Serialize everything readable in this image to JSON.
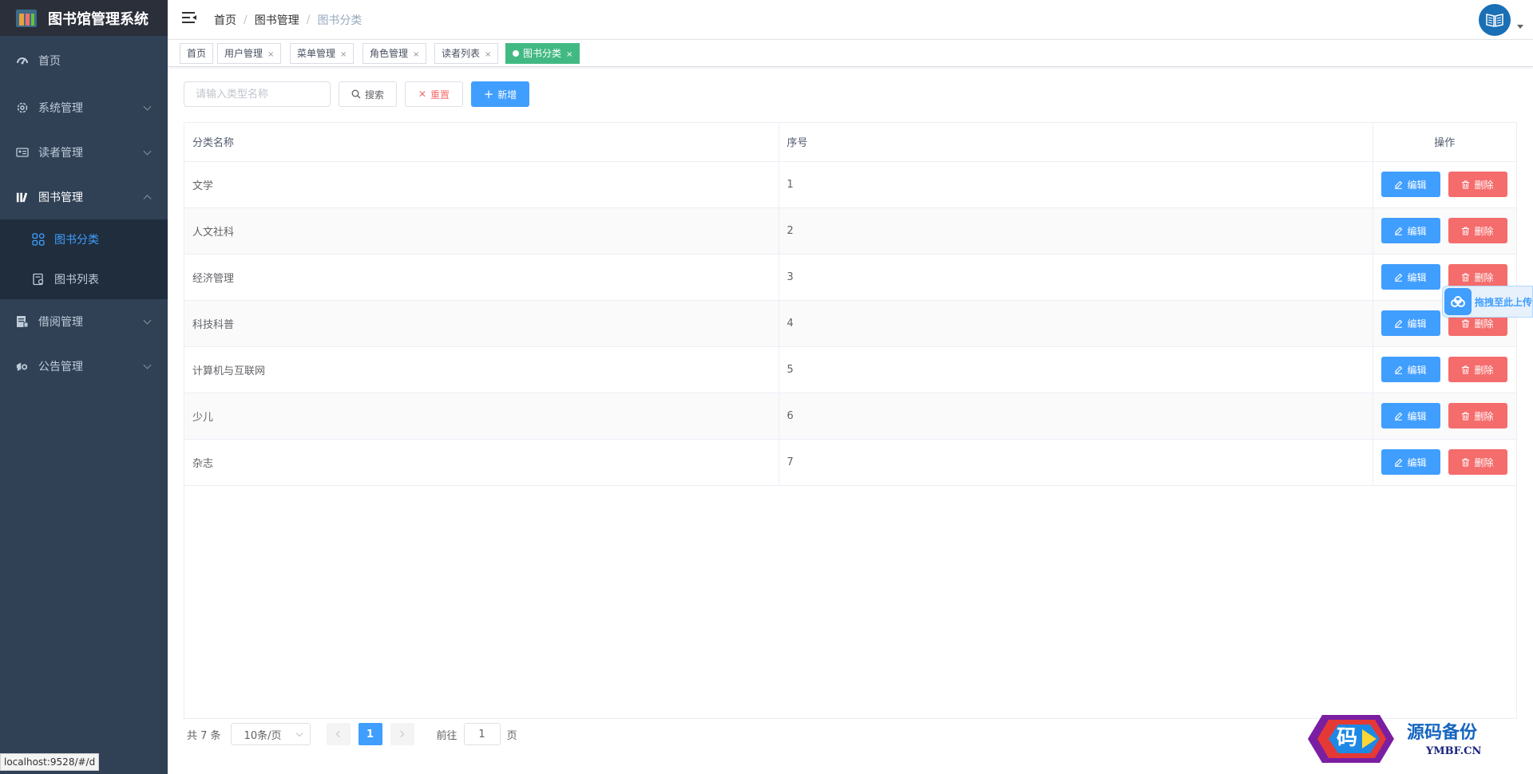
{
  "app": {
    "title": "图书馆管理系统"
  },
  "sidebar": {
    "items": [
      {
        "label": "首页",
        "icon": "dashboard-icon"
      },
      {
        "label": "系统管理",
        "icon": "gear-icon"
      },
      {
        "label": "读者管理",
        "icon": "id-card-icon"
      },
      {
        "label": "图书管理",
        "icon": "books-icon"
      },
      {
        "label": "借阅管理",
        "icon": "borrow-icon"
      },
      {
        "label": "公告管理",
        "icon": "announcement-icon"
      }
    ],
    "subitems": [
      {
        "label": "图书分类",
        "icon": "category-icon",
        "active": true
      },
      {
        "label": "图书列表",
        "icon": "book-list-icon"
      }
    ]
  },
  "breadcrumb": {
    "items": [
      "首页",
      "图书管理",
      "图书分类"
    ],
    "separator": "/"
  },
  "tags": [
    {
      "label": "首页"
    },
    {
      "label": "用户管理",
      "close": "×"
    },
    {
      "label": "菜单管理",
      "close": "×"
    },
    {
      "label": "角色管理",
      "close": "×"
    },
    {
      "label": "读者列表",
      "close": "×"
    },
    {
      "label": "图书分类",
      "close": "×",
      "active": true
    }
  ],
  "search": {
    "placeholder": "请输入类型名称",
    "search_label": "搜索",
    "reset_label": "重置",
    "add_label": "新增"
  },
  "table": {
    "headers": [
      "分类名称",
      "序号",
      "操作"
    ],
    "edit_label": "编辑",
    "delete_label": "删除",
    "rows": [
      {
        "name": "文学",
        "order": "1"
      },
      {
        "name": "人文社科",
        "order": "2"
      },
      {
        "name": "经济管理",
        "order": "3"
      },
      {
        "name": "科技科普",
        "order": "4"
      },
      {
        "name": "计算机与互联网",
        "order": "5"
      },
      {
        "name": "少儿",
        "order": "6"
      },
      {
        "name": "杂志",
        "order": "7"
      }
    ]
  },
  "pagination": {
    "total": "共 7 条",
    "page_size": "10条/页",
    "current_page": "1",
    "goto_prefix": "前往",
    "goto_value": "1",
    "goto_suffix": "页"
  },
  "upload_float": {
    "text": "拖拽至此上传"
  },
  "watermark": {
    "title": "源码备份",
    "subtitle": "YMBF.CN",
    "glyph": "码"
  },
  "status_url": "localhost:9528/#/d",
  "colors": {
    "sidebar_bg": "#304156",
    "submenu_bg": "#1f2d3d",
    "primary": "#409eff",
    "danger": "#f56c6c",
    "tag_active": "#42b983"
  }
}
